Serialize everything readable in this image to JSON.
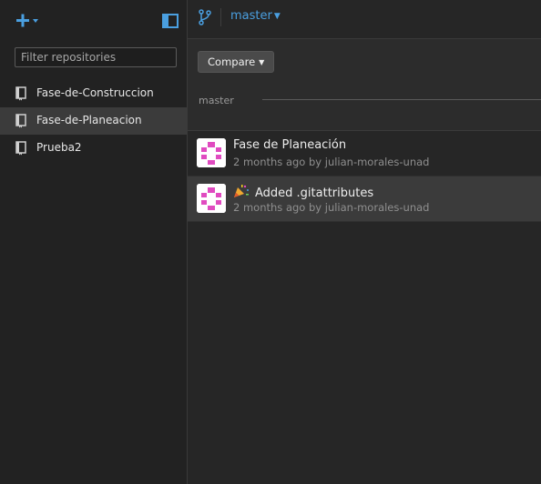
{
  "sidebar": {
    "add_icon": "plus-icon",
    "panel_icon": "sidebar-toggle-icon",
    "filter_placeholder": "Filter repositories",
    "filter_value": "",
    "repos": [
      {
        "label": "Fase-de-Construccion",
        "icon": "repo-book-icon",
        "selected": false
      },
      {
        "label": "Fase-de-Planeacion",
        "icon": "repo-book-icon",
        "selected": true
      },
      {
        "label": "Prueba2",
        "icon": "repo-book-icon",
        "selected": false
      }
    ]
  },
  "topbar": {
    "branch_icon": "git-branch-icon",
    "branch_name": "master"
  },
  "compare": {
    "button_label": "Compare",
    "branch_label": "master"
  },
  "commits": [
    {
      "title": "Fase de Planeación",
      "meta": "2 months ago by julian-morales-unad",
      "emoji": "",
      "selected": false
    },
    {
      "title": "Added .gitattributes",
      "meta": "2 months ago by julian-morales-unad",
      "emoji": "party-popper-icon",
      "selected": true
    }
  ],
  "colors": {
    "accent": "#4a9fe0",
    "avatar_pink": "#e04bc0",
    "background": "#262626",
    "sidebar_bg": "#222222",
    "selected_bg": "#3b3b3b"
  }
}
